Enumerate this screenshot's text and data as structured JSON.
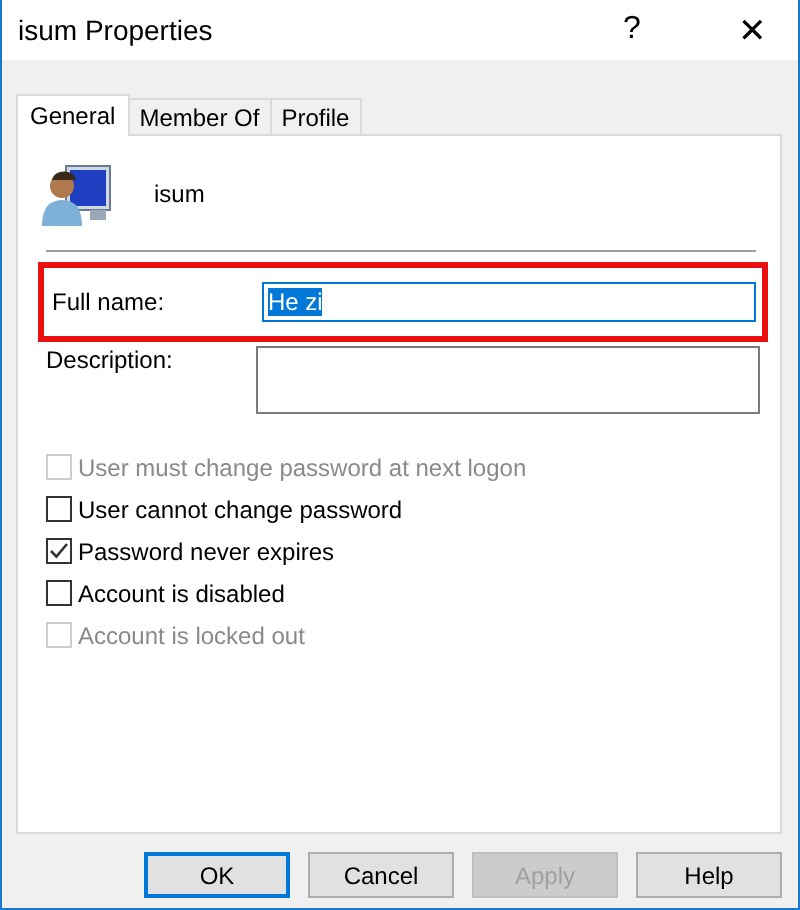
{
  "window": {
    "title": "isum Properties",
    "help": "?",
    "close": "✕"
  },
  "tabs": [
    {
      "label": "General",
      "selected": true
    },
    {
      "label": "Member Of",
      "selected": false
    },
    {
      "label": "Profile",
      "selected": false
    }
  ],
  "user": {
    "name": "isum"
  },
  "fields": [
    {
      "label": "Full name:",
      "value": "He zi",
      "text_selected": true,
      "highlighted": true,
      "multiline": false
    },
    {
      "label": "Description:",
      "highlighted": false,
      "multiline": true
    }
  ],
  "checkboxes": [
    {
      "label": "User must change password at next logon",
      "checked": false,
      "disabled": true
    },
    {
      "label": "User cannot change password",
      "checked": false,
      "disabled": false
    },
    {
      "label": "Password never expires",
      "checked": true,
      "disabled": false
    },
    {
      "label": "Account is disabled",
      "checked": false,
      "disabled": false
    },
    {
      "label": "Account is locked out",
      "checked": false,
      "disabled": true
    }
  ],
  "buttons": [
    {
      "label": "OK",
      "default": true,
      "disabled": false
    },
    {
      "label": "Cancel",
      "default": false,
      "disabled": false
    },
    {
      "label": "Apply",
      "default": false,
      "disabled": true
    },
    {
      "label": "Help",
      "default": false,
      "disabled": false
    }
  ]
}
